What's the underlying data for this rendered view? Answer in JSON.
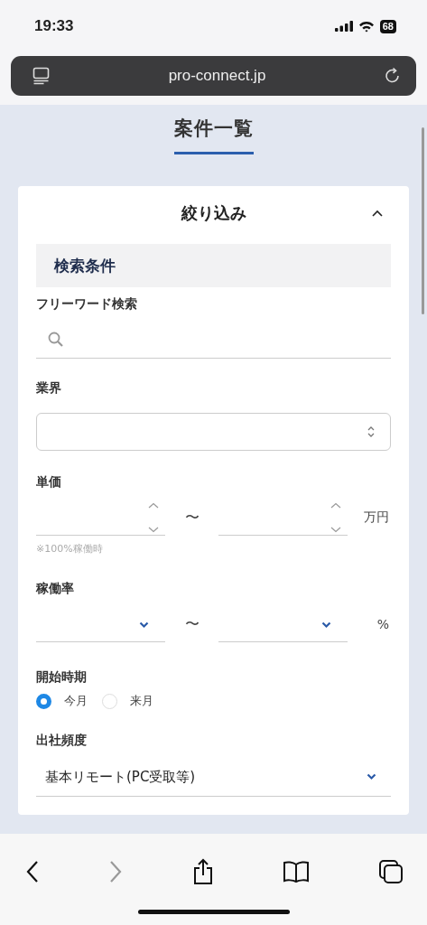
{
  "status_bar": {
    "time": "19:33",
    "battery": "68"
  },
  "browser": {
    "url": "pro-connect.jp"
  },
  "page": {
    "title": "案件一覧"
  },
  "filter": {
    "title": "絞り込み",
    "expanded": true,
    "section_title": "検索条件",
    "fields": [
      {
        "kind": "search",
        "label": "フリーワード検索"
      },
      {
        "kind": "select_box",
        "label": "業界"
      },
      {
        "kind": "number_range",
        "label": "単価",
        "separator": "〜",
        "unit": "万円",
        "note": "※100%稼働時"
      },
      {
        "kind": "select_range",
        "label": "稼働率",
        "separator": "〜",
        "unit": "%"
      },
      {
        "kind": "radio",
        "label": "開始時期",
        "options": [
          {
            "label": "今月",
            "selected": true
          },
          {
            "label": "来月",
            "selected": false
          }
        ]
      },
      {
        "kind": "select",
        "label": "出社頻度",
        "value": "基本リモート(PC受取等)"
      }
    ]
  }
}
